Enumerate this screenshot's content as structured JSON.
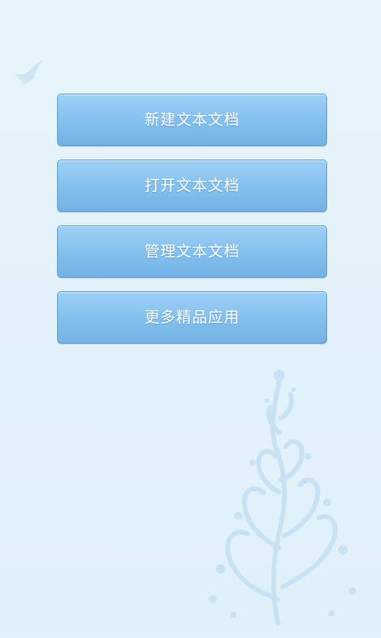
{
  "menu": {
    "items": [
      {
        "label": "新建文本文档"
      },
      {
        "label": "打开文本文档"
      },
      {
        "label": "管理文本文档"
      },
      {
        "label": "更多精品应用"
      }
    ]
  },
  "decor": {
    "bird_icon": "dove-icon",
    "tree_icon": "swirl-tree-icon",
    "accent": "#87c2ef",
    "background": "#e1f1fa"
  }
}
